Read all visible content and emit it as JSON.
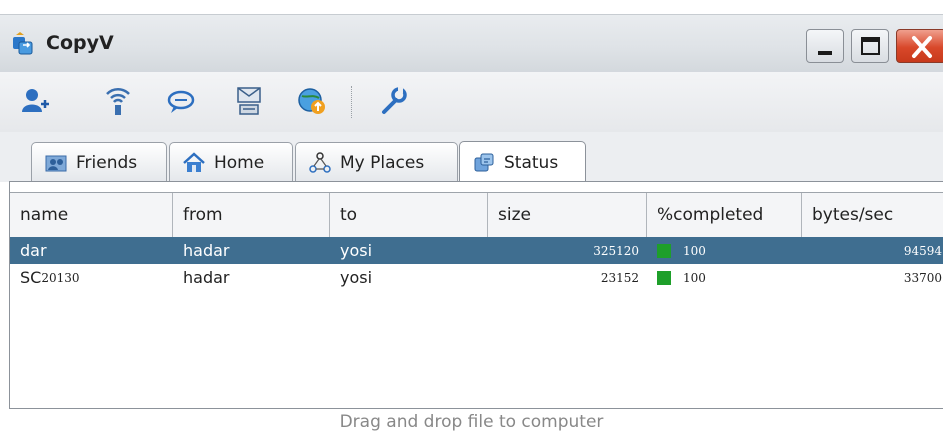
{
  "window": {
    "title": "CopyV"
  },
  "toolbar": {
    "tools": [
      {
        "icon": "add-user-icon"
      },
      {
        "icon": "wireless-icon"
      },
      {
        "icon": "chat-icon"
      },
      {
        "icon": "mail-network-icon"
      },
      {
        "icon": "globe-upload-icon"
      },
      {
        "icon": "wrench-icon"
      }
    ]
  },
  "tabs": [
    {
      "label": "Friends",
      "icon": "friends-icon"
    },
    {
      "label": "Home",
      "icon": "home-icon"
    },
    {
      "label": "My Places",
      "icon": "places-icon"
    },
    {
      "label": "Status",
      "icon": "status-icon",
      "active": true
    }
  ],
  "grid": {
    "columns": [
      "name",
      "from",
      "to",
      "size",
      "%completed",
      "bytes/sec"
    ],
    "rows": [
      {
        "name": "dar",
        "from": "hadar",
        "to": "yosi",
        "size": "325120",
        "completed": "100",
        "bytes_sec": "94594",
        "selected": true
      },
      {
        "name": "SC20130",
        "name_main": "SC",
        "name_small": "20130",
        "from": "hadar",
        "to": "yosi",
        "size": "23152",
        "completed": "100",
        "bytes_sec": "33700",
        "selected": false
      }
    ]
  },
  "footer": {
    "hint": "Drag and drop file to computer"
  },
  "colors": {
    "selection": "#3f6e90",
    "progress": "#1e9f2a",
    "close_button": "#d8482a"
  }
}
